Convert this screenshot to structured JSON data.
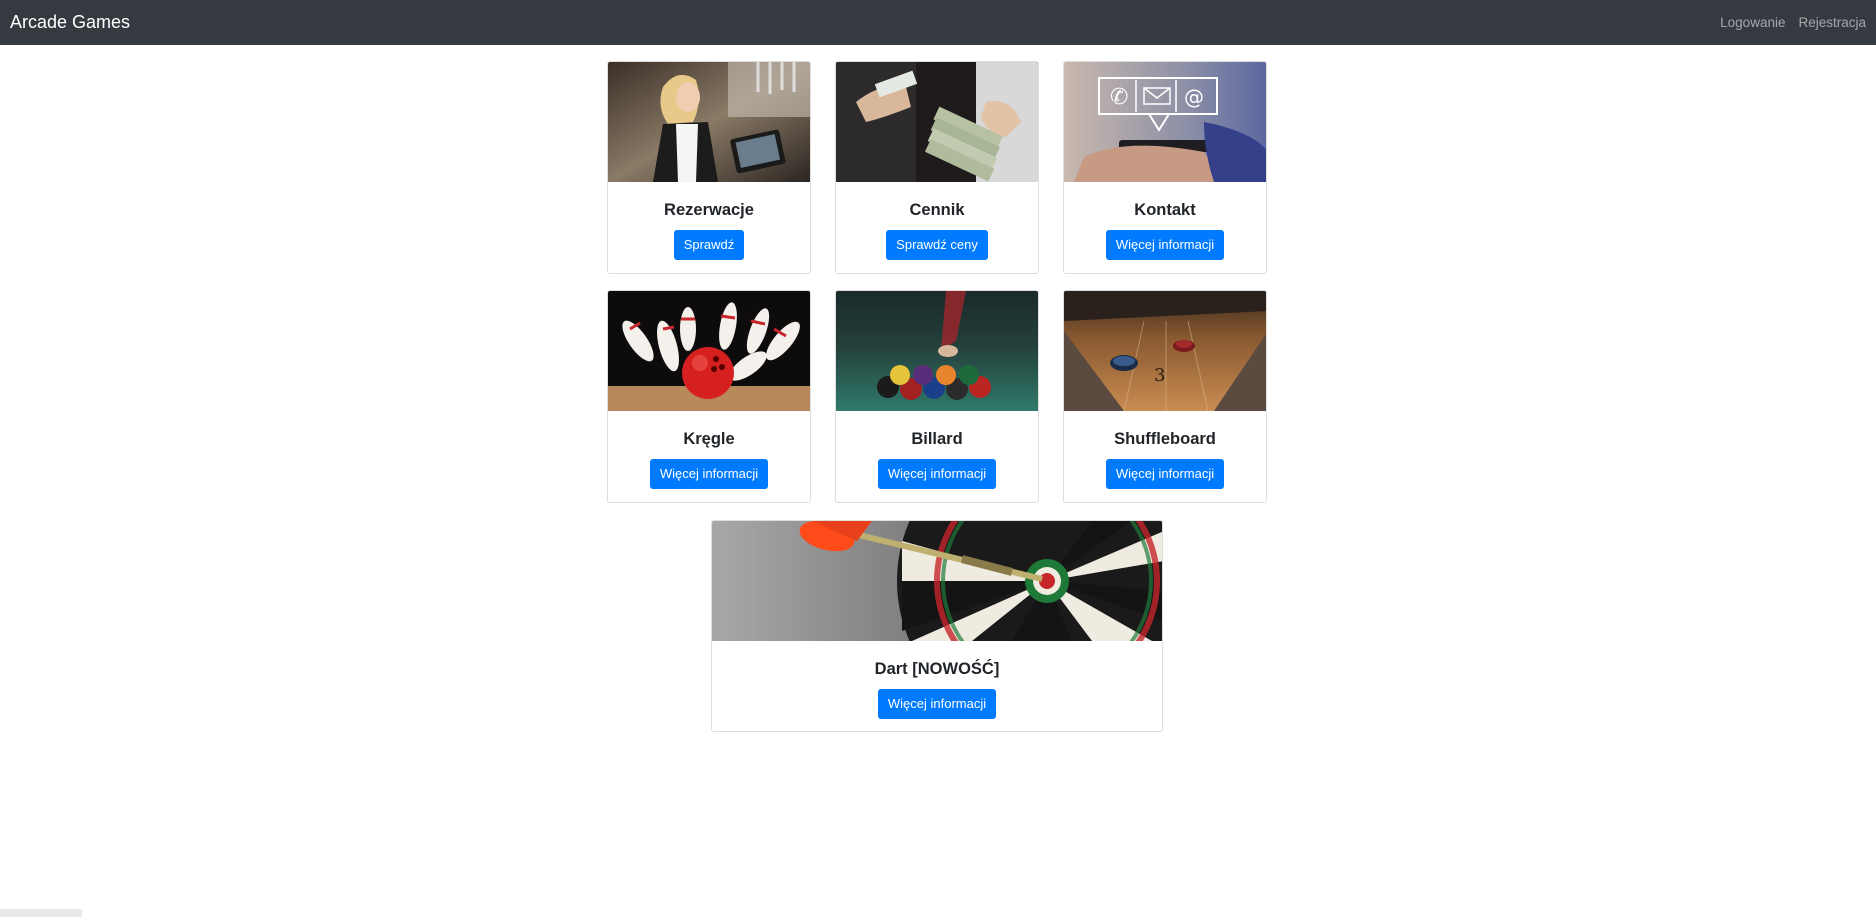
{
  "navbar": {
    "brand": "Arcade Games",
    "links": [
      "Logowanie",
      "Rejestracja"
    ]
  },
  "cards": [
    {
      "title": "Rezerwacje",
      "button": "Sprawdź",
      "image": "cashier-photo"
    },
    {
      "title": "Cennik",
      "button": "Sprawdź ceny",
      "image": "money-photo"
    },
    {
      "title": "Kontakt",
      "button": "Więcej informacji",
      "image": "contact-phone-photo"
    },
    {
      "title": "Kręgle",
      "button": "Więcej informacji",
      "image": "bowling-photo"
    },
    {
      "title": "Billard",
      "button": "Więcej informacji",
      "image": "billiards-photo"
    },
    {
      "title": "Shuffleboard",
      "button": "Więcej informacji",
      "image": "shuffleboard-photo"
    },
    {
      "title": "Dart [NOWOŚĆ]",
      "button": "Więcej informacji",
      "image": "darts-photo"
    }
  ],
  "colors": {
    "navbar": "#343a40",
    "primary": "#007bff"
  }
}
